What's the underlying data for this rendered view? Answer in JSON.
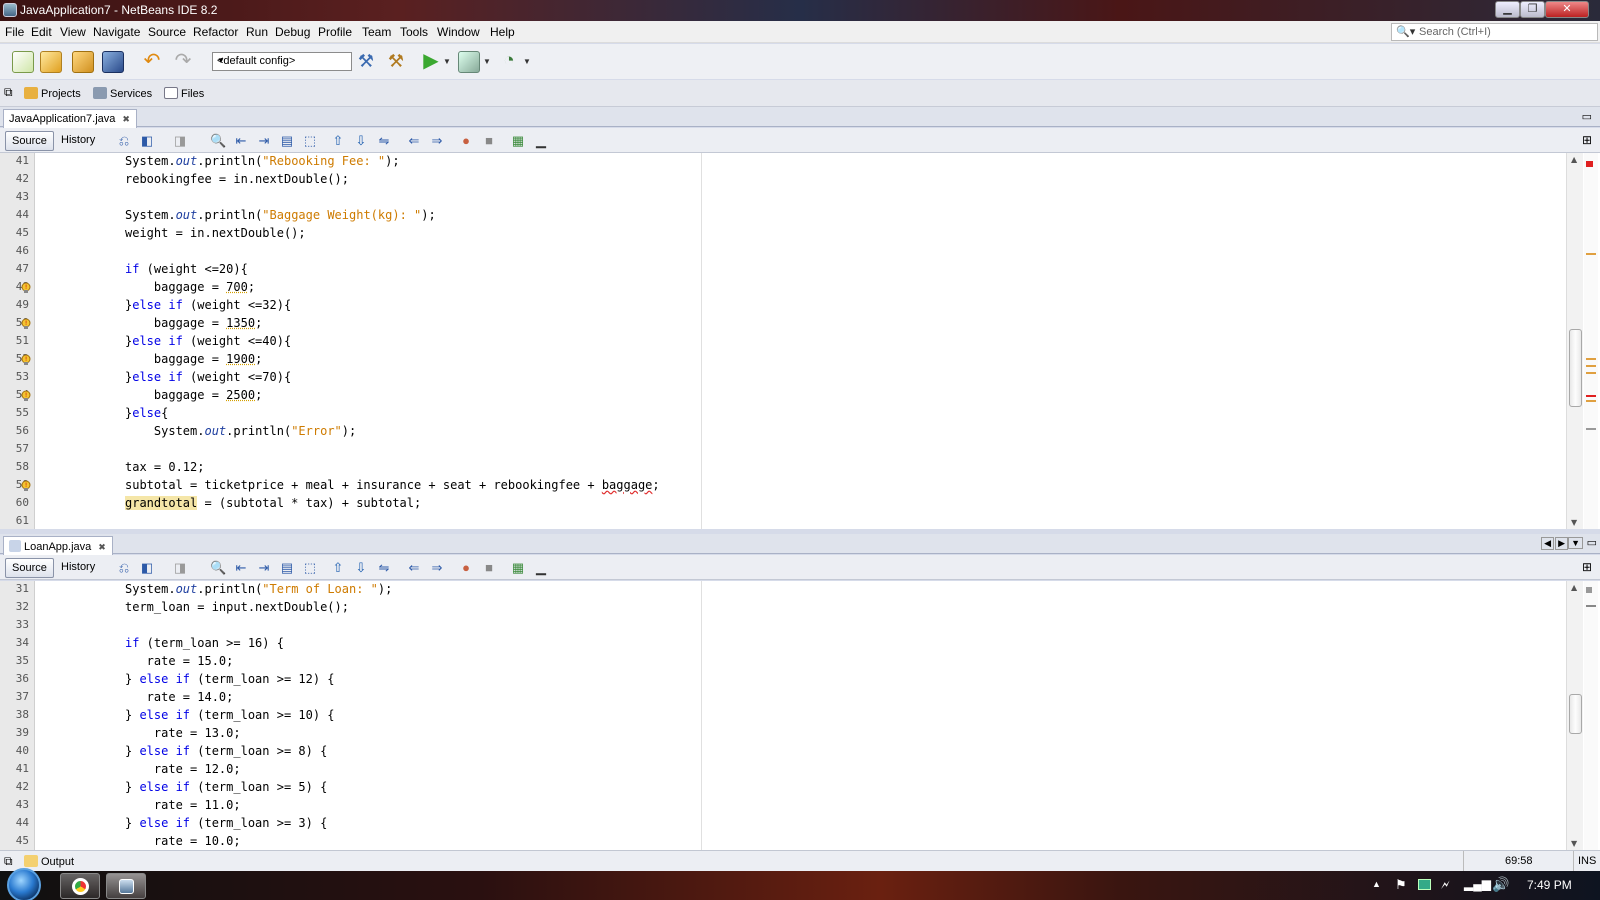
{
  "window": {
    "title": "JavaApplication7 - NetBeans IDE 8.2",
    "min": "▁",
    "max": "❐",
    "close": "✕"
  },
  "menu": [
    "File",
    "Edit",
    "View",
    "Navigate",
    "Source",
    "Refactor",
    "Run",
    "Debug",
    "Profile",
    "Team",
    "Tools",
    "Window",
    "Help"
  ],
  "search": {
    "icon": "search-icon",
    "placeholder": "Search (Ctrl+I)"
  },
  "toolbar": {
    "config": "<default config>"
  },
  "toolwindows": {
    "projects": "Projects",
    "services": "Services",
    "files": "Files"
  },
  "editor1": {
    "tab": "JavaApplication7.java",
    "source": "Source",
    "history": "History",
    "lines": [
      {
        "n": "41",
        "segs": [
          [
            "",
            "System."
          ],
          [
            "it",
            "out"
          ],
          [
            "",
            ".println("
          ],
          [
            "str",
            "\"Rebooking Fee: \""
          ],
          [
            "",
            ");"
          ]
        ]
      },
      {
        "n": "42",
        "segs": [
          [
            "",
            "rebookingfee = in.nextDouble();"
          ]
        ]
      },
      {
        "n": "43",
        "segs": []
      },
      {
        "n": "44",
        "segs": [
          [
            "",
            "System."
          ],
          [
            "it",
            "out"
          ],
          [
            "",
            ".println("
          ],
          [
            "str",
            "\"Baggage Weight(kg): \""
          ],
          [
            "",
            ");"
          ]
        ]
      },
      {
        "n": "45",
        "segs": [
          [
            "",
            "weight = in.nextDouble();"
          ]
        ]
      },
      {
        "n": "46",
        "segs": []
      },
      {
        "n": "47",
        "segs": [
          [
            "kw",
            "if"
          ],
          [
            "",
            " (weight <=20){"
          ]
        ]
      },
      {
        "n": "48",
        "bulb": true,
        "segs": [
          [
            "",
            "    baggage = "
          ],
          [
            "num",
            "700"
          ],
          [
            "",
            ";"
          ]
        ]
      },
      {
        "n": "49",
        "segs": [
          [
            "",
            "}"
          ],
          [
            "kw",
            "else if"
          ],
          [
            "",
            " (weight <=32){"
          ]
        ]
      },
      {
        "n": "50",
        "bulb": true,
        "segs": [
          [
            "",
            "    baggage = "
          ],
          [
            "num",
            "1350"
          ],
          [
            "",
            ";"
          ]
        ]
      },
      {
        "n": "51",
        "segs": [
          [
            "",
            "}"
          ],
          [
            "kw",
            "else if"
          ],
          [
            "",
            " (weight <=40){"
          ]
        ]
      },
      {
        "n": "52",
        "bulb": true,
        "segs": [
          [
            "",
            "    baggage = "
          ],
          [
            "num",
            "1900"
          ],
          [
            "",
            ";"
          ]
        ]
      },
      {
        "n": "53",
        "segs": [
          [
            "",
            "}"
          ],
          [
            "kw",
            "else if"
          ],
          [
            "",
            " (weight <=70){"
          ]
        ]
      },
      {
        "n": "54",
        "bulb": true,
        "segs": [
          [
            "",
            "    baggage = "
          ],
          [
            "num",
            "2500"
          ],
          [
            "",
            ";"
          ]
        ]
      },
      {
        "n": "55",
        "segs": [
          [
            "",
            "}"
          ],
          [
            "kw",
            "else"
          ],
          [
            "",
            "{"
          ]
        ]
      },
      {
        "n": "56",
        "segs": [
          [
            "",
            "    System."
          ],
          [
            "it",
            "out"
          ],
          [
            "",
            ".println("
          ],
          [
            "str",
            "\"Error\""
          ],
          [
            "",
            ");"
          ]
        ]
      },
      {
        "n": "57",
        "segs": []
      },
      {
        "n": "58",
        "segs": [
          [
            "",
            "tax = 0.12;"
          ]
        ]
      },
      {
        "n": "59",
        "bulb": true,
        "segs": [
          [
            "",
            "subtotal = ticketprice + meal + insurance + seat + rebookingfee + "
          ],
          [
            "sq",
            "baggage"
          ],
          [
            "",
            ";"
          ]
        ]
      },
      {
        "n": "60",
        "segs": [
          [
            "hl",
            "grandtotal"
          ],
          [
            "",
            " = (subtotal * tax) + subtotal;"
          ]
        ]
      },
      {
        "n": "61",
        "segs": []
      }
    ]
  },
  "editor2": {
    "tab": "LoanApp.java",
    "source": "Source",
    "history": "History",
    "lines": [
      {
        "n": "31",
        "segs": [
          [
            "",
            "System."
          ],
          [
            "it",
            "out"
          ],
          [
            "",
            ".println("
          ],
          [
            "str",
            "\"Term of Loan: \""
          ],
          [
            "",
            ");"
          ]
        ]
      },
      {
        "n": "32",
        "segs": [
          [
            "",
            "term_loan = input.nextDouble();"
          ]
        ]
      },
      {
        "n": "33",
        "segs": []
      },
      {
        "n": "34",
        "segs": [
          [
            "kw",
            "if"
          ],
          [
            "",
            " (term_loan >= 16) {"
          ]
        ]
      },
      {
        "n": "35",
        "segs": [
          [
            "",
            "   rate = 15.0;"
          ]
        ]
      },
      {
        "n": "36",
        "segs": [
          [
            "",
            "} "
          ],
          [
            "kw",
            "else if"
          ],
          [
            "",
            " (term_loan >= 12) {"
          ]
        ]
      },
      {
        "n": "37",
        "segs": [
          [
            "",
            "   rate = 14.0;"
          ]
        ]
      },
      {
        "n": "38",
        "segs": [
          [
            "",
            "} "
          ],
          [
            "kw",
            "else if"
          ],
          [
            "",
            " (term_loan >= 10) {"
          ]
        ]
      },
      {
        "n": "39",
        "segs": [
          [
            "",
            "    rate = 13.0;"
          ]
        ]
      },
      {
        "n": "40",
        "segs": [
          [
            "",
            "} "
          ],
          [
            "kw",
            "else if"
          ],
          [
            "",
            " (term_loan >= 8) {"
          ]
        ]
      },
      {
        "n": "41",
        "segs": [
          [
            "",
            "    rate = 12.0;"
          ]
        ]
      },
      {
        "n": "42",
        "segs": [
          [
            "",
            "} "
          ],
          [
            "kw",
            "else if"
          ],
          [
            "",
            " (term_loan >= 5) {"
          ]
        ]
      },
      {
        "n": "43",
        "segs": [
          [
            "",
            "    rate = 11.0;"
          ]
        ]
      },
      {
        "n": "44",
        "segs": [
          [
            "",
            "} "
          ],
          [
            "kw",
            "else if"
          ],
          [
            "",
            " (term_loan >= 3) {"
          ]
        ]
      },
      {
        "n": "45",
        "segs": [
          [
            "",
            "    rate = 10.0;"
          ]
        ]
      }
    ]
  },
  "status": {
    "output": "Output",
    "position": "69:58",
    "mode": "INS"
  },
  "taskbar": {
    "time": "7:49 PM"
  }
}
